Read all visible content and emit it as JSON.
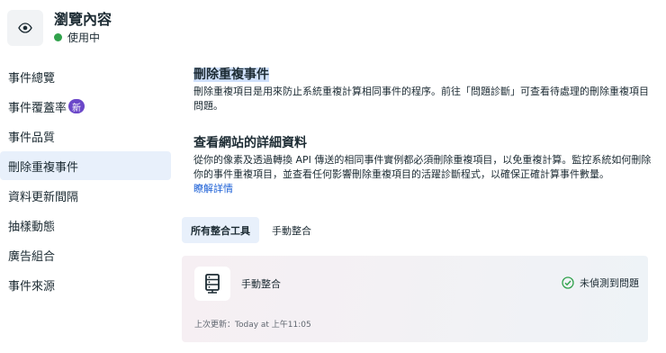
{
  "header": {
    "title": "瀏覽內容",
    "status": "使用中",
    "icon": "eye-icon",
    "status_color": "#31a24c"
  },
  "sidebar": {
    "items": [
      {
        "label": "事件總覽"
      },
      {
        "label": "事件覆蓋率",
        "badge": "新"
      },
      {
        "label": "事件品質"
      },
      {
        "label": "刪除重複事件",
        "active": true
      },
      {
        "label": "資料更新間隔"
      },
      {
        "label": "抽樣動態"
      },
      {
        "label": "廣告組合"
      },
      {
        "label": "事件來源"
      }
    ]
  },
  "main": {
    "section1": {
      "title": "刪除重複事件",
      "body": "刪除重複項目是用來防止系統重複計算相同事件的程序。前往「問題診斷」可查看待處理的刪除重複項目問題。"
    },
    "section2": {
      "title": "查看網站的詳細資料",
      "body": "從你的像素及透過轉換 API 傳送的相同事件實例都必須刪除重複項目，以免重複計算。監控系統如何刪除你的事件重複項目，並查看任何影響刪除重複項目的活躍診斷程式，以確保正確計算事件數量。",
      "link": "瞭解詳情"
    },
    "tabs": [
      {
        "label": "所有整合工具",
        "active": true
      },
      {
        "label": "手動整合"
      }
    ],
    "card": {
      "icon": "server-icon",
      "name": "手動整合",
      "status": "未偵測到問題",
      "status_icon": "check-circle-icon",
      "updated": "上次更新：Today at 上午11:05"
    }
  },
  "colors": {
    "accent": "#1b5fd6",
    "active_bg": "#e8f0fb",
    "badge": "#6b47c9",
    "success": "#31a24c"
  }
}
